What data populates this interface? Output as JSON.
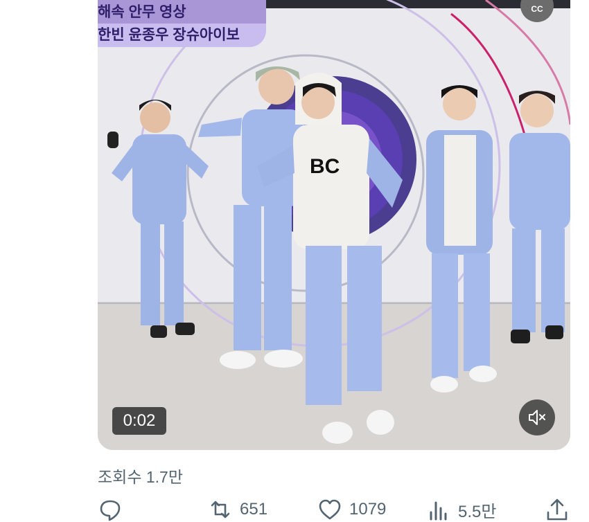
{
  "video": {
    "overlay_line1": "해속 안무 영상",
    "overlay_line2": "한빈 윤종우 장슈아이보",
    "cc_label": "CC",
    "timestamp": "0:02",
    "shirt_text": "BC"
  },
  "stats": {
    "views": "조회수 1.7만"
  },
  "actions": {
    "retweets": "651",
    "likes": "1079",
    "analytics": "5.5만"
  },
  "icons": [
    "reply-icon",
    "retweet-icon",
    "like-icon",
    "analytics-icon",
    "share-icon",
    "mute-icon",
    "captions-icon"
  ]
}
